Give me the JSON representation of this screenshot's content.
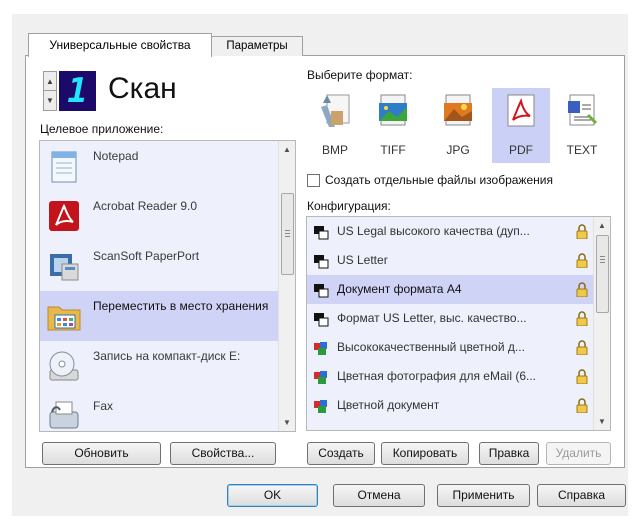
{
  "tabs": [
    {
      "label": "Универсальные свойства"
    },
    {
      "label": "Параметры"
    }
  ],
  "scan": {
    "button_number": "1",
    "title": "Скан"
  },
  "apps": {
    "label": "Целевое приложение:",
    "items": [
      {
        "name": "Notepad",
        "icon": "notepad-icon"
      },
      {
        "name": "Acrobat Reader 9.0",
        "icon": "acrobat-reader-icon"
      },
      {
        "name": "ScanSoft PaperPort",
        "icon": "paperport-icon"
      },
      {
        "name": "Переместить в место хранения",
        "icon": "folder-icon",
        "selected": true
      },
      {
        "name": "Запись на компакт-диск E:",
        "icon": "cd-burn-icon"
      },
      {
        "name": "Fax",
        "icon": "fax-icon"
      }
    ]
  },
  "format": {
    "label": "Выберите формат:",
    "items": [
      {
        "label": "BMP",
        "icon": "bmp-format-icon"
      },
      {
        "label": "TIFF",
        "icon": "tiff-format-icon"
      },
      {
        "label": "JPG",
        "icon": "jpg-format-icon"
      },
      {
        "label": "PDF",
        "icon": "pdf-format-icon",
        "selected": true
      },
      {
        "label": "TEXT",
        "icon": "text-format-icon"
      }
    ],
    "separate_files_label": "Создать отдельные файлы изображения",
    "separate_files_checked": false
  },
  "config": {
    "label": "Конфигурация:",
    "items": [
      {
        "name": "US Legal высокого качества (дуп...",
        "icon": "bw-config-icon"
      },
      {
        "name": "US Letter",
        "icon": "bw-config-icon"
      },
      {
        "name": "Документ формата А4",
        "icon": "bw-config-icon",
        "selected": true
      },
      {
        "name": "Формат US Letter, выс. качество...",
        "icon": "bw-config-icon"
      },
      {
        "name": "Высококачественный цветной д...",
        "icon": "color-config-icon"
      },
      {
        "name": "Цветная фотография для eMail (6...",
        "icon": "color-config-icon"
      },
      {
        "name": "Цветной документ",
        "icon": "color-config-icon"
      }
    ]
  },
  "buttons": {
    "refresh": "Обновить",
    "properties": "Свойства...",
    "create": "Создать",
    "copy": "Копировать",
    "edit": "Правка",
    "delete": "Удалить",
    "ok": "OK",
    "cancel": "Отмена",
    "apply": "Применить",
    "help": "Справка"
  },
  "colors": {
    "selection": "#cfd4f7",
    "list_background": "#eef1fb",
    "lcd_background": "#1c0a6b",
    "lcd_digit": "#22e6ff"
  }
}
